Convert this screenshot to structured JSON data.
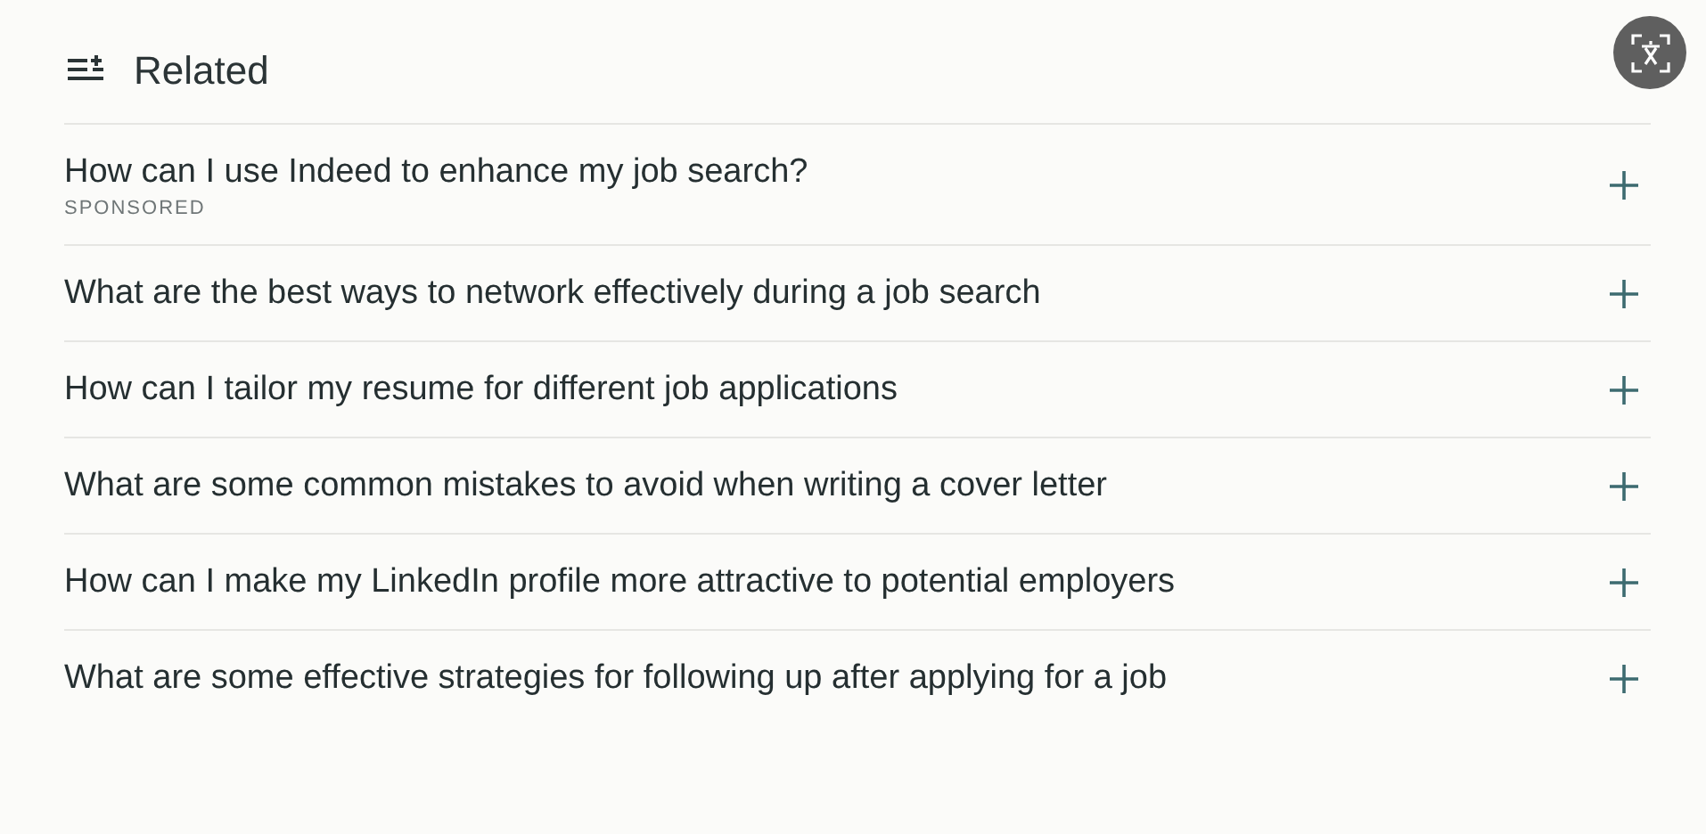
{
  "header": {
    "title": "Related"
  },
  "items": [
    {
      "question": "How can I use Indeed to enhance my job search?",
      "tag": "SPONSORED"
    },
    {
      "question": "What are the best ways to network effectively during a job search"
    },
    {
      "question": "How can I tailor my resume for different job applications"
    },
    {
      "question": "What are some common mistakes to avoid when writing a cover letter"
    },
    {
      "question": "How can I make my LinkedIn profile more attractive to potential employers"
    },
    {
      "question": "What are some effective strategies for following up after applying for a job"
    }
  ]
}
